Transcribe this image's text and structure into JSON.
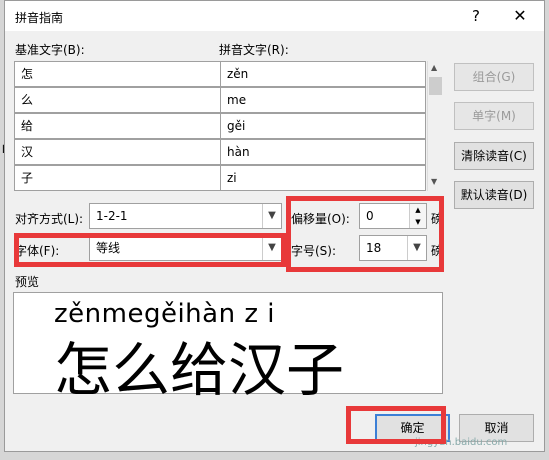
{
  "dialog": {
    "title": "拼音指南",
    "help": "?",
    "close": "✕"
  },
  "background": {
    "glyph": "\""
  },
  "labels": {
    "base_text": "基准文字(B):",
    "pinyin_text": "拼音文字(R):",
    "alignment": "对齐方式(L):",
    "offset": "偏移量(O):",
    "font": "字体(F):",
    "size": "字号(S):",
    "preview": "预览",
    "unit_offset": "磅",
    "unit_size": "磅"
  },
  "rows": [
    {
      "base": "怎",
      "pinyin": "zěn"
    },
    {
      "base": "么",
      "pinyin": "me"
    },
    {
      "base": "给",
      "pinyin": "gěi"
    },
    {
      "base": "汉",
      "pinyin": "hàn"
    },
    {
      "base": "子",
      "pinyin": "zi"
    }
  ],
  "fields": {
    "alignment": "1-2-1",
    "offset": "0",
    "font": "等线",
    "size": "18"
  },
  "buttons": {
    "group": "组合(G)",
    "single": "单字(M)",
    "clear": "清除读音(C)",
    "default_reading": "默认读音(D)",
    "ok": "确定",
    "cancel": "取消"
  },
  "preview": {
    "pinyin": "zěnmegěihàn z i",
    "hanzi": "怎么给汉子"
  },
  "watermark": "jingyan.baidu.com"
}
